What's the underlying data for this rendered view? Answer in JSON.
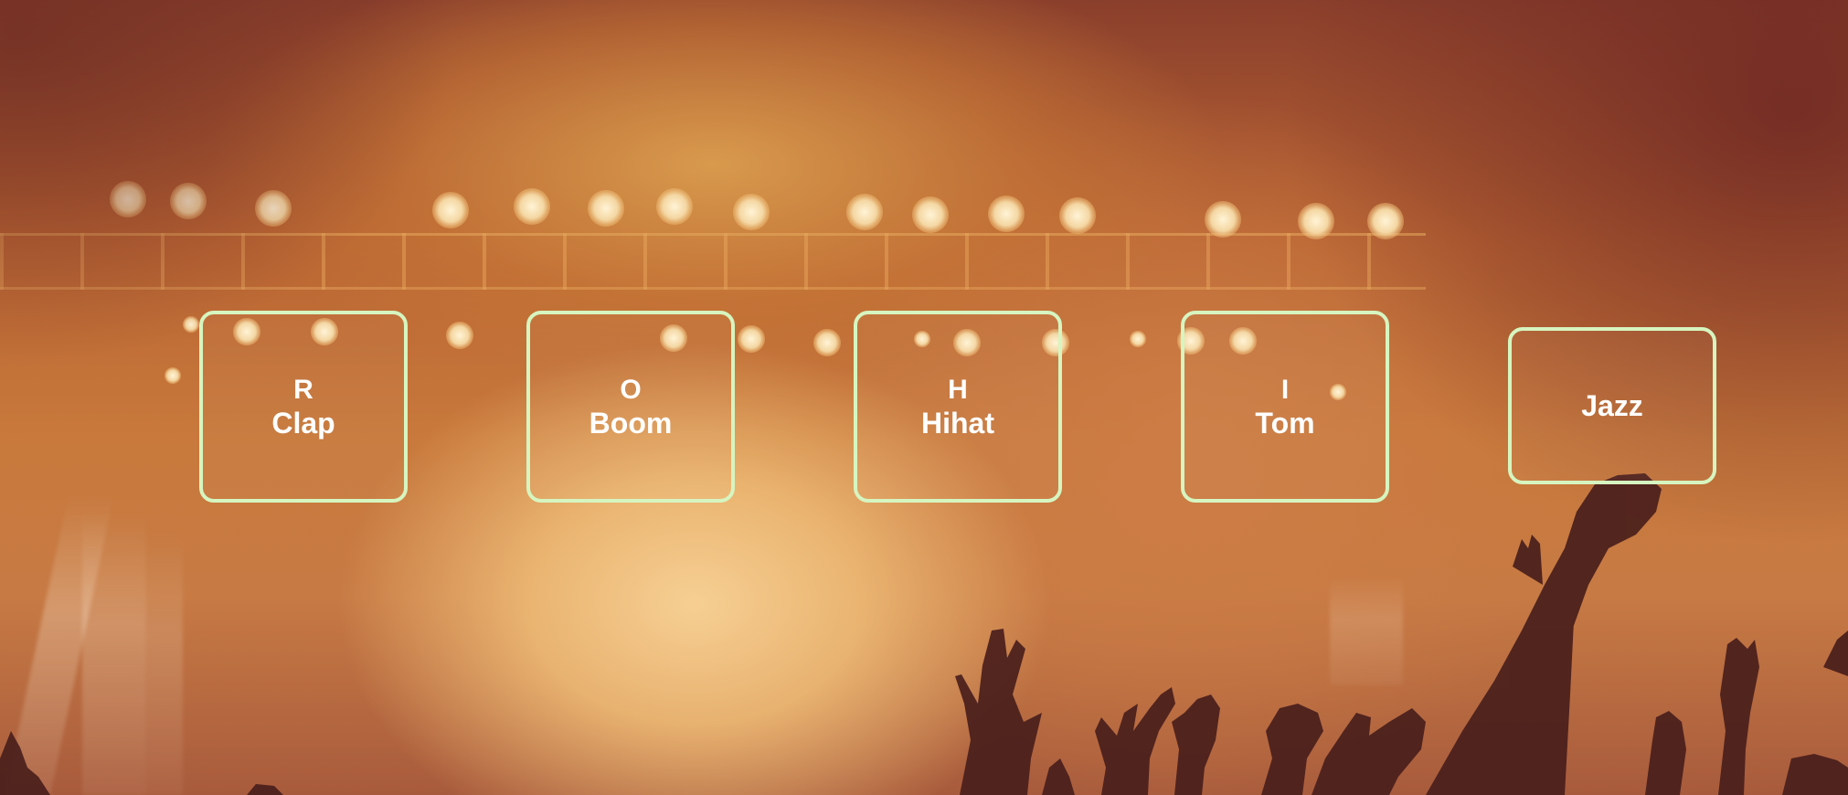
{
  "pads": [
    {
      "key": "R",
      "sound": "Clap"
    },
    {
      "key": "O",
      "sound": "Boom"
    },
    {
      "key": "H",
      "sound": "Hihat"
    },
    {
      "key": "I",
      "sound": "Tom"
    },
    {
      "key": "",
      "sound": "Jazz"
    }
  ],
  "colors": {
    "pad_border": "#d6f5c0",
    "pad_text": "#ffffff"
  }
}
